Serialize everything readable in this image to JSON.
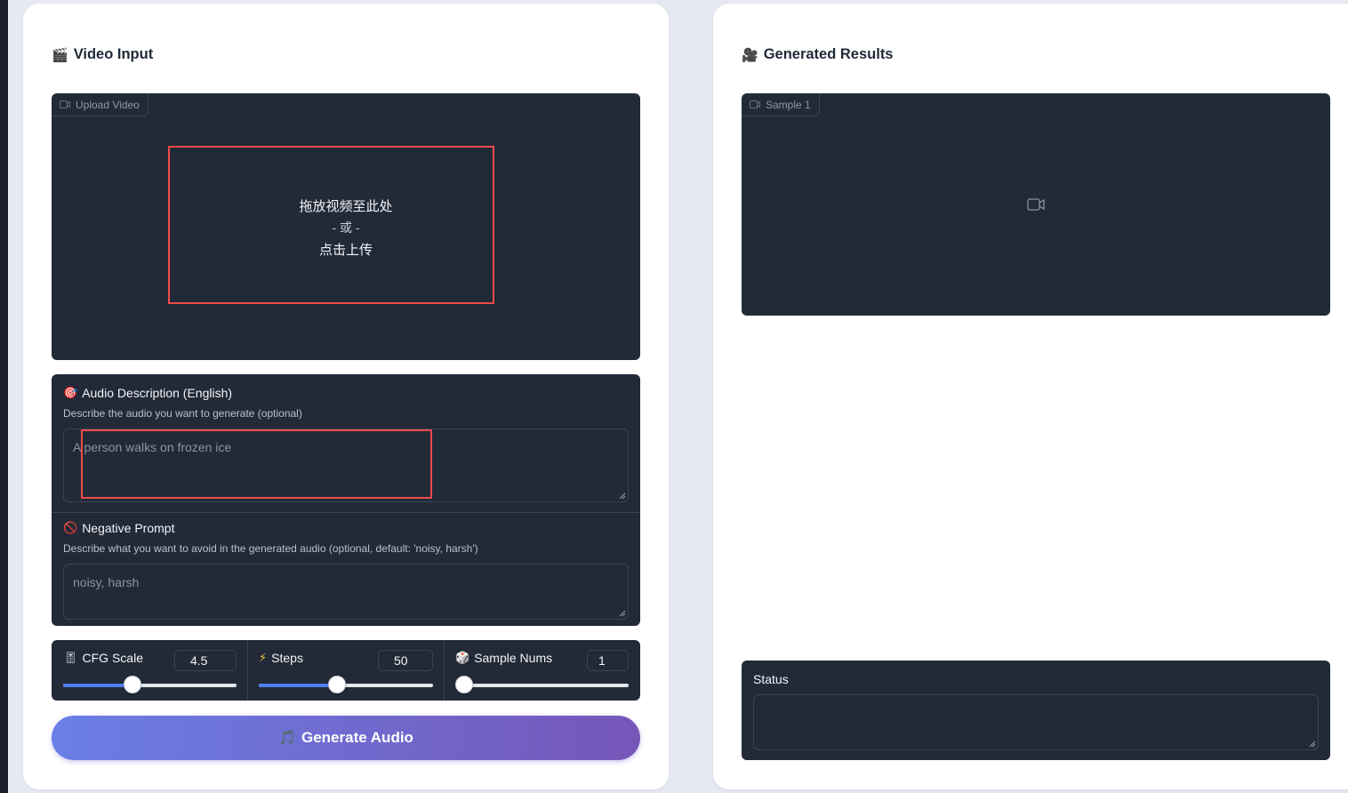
{
  "left": {
    "title": "Video Input",
    "title_icon": "🎬",
    "upload": {
      "tag": "Upload Video",
      "line1": "拖放视频至此处",
      "line2": "- 或 -",
      "line3": "点击上传"
    },
    "audio_description": {
      "icon": "🎯",
      "label": "Audio Description (English)",
      "info": "Describe the audio you want to generate (optional)",
      "placeholder": "A person walks on frozen ice"
    },
    "negative_prompt": {
      "icon": "🚫",
      "label": "Negative Prompt",
      "info": "Describe what you want to avoid in the generated audio (optional, default: 'noisy, harsh')",
      "placeholder": "noisy, harsh"
    },
    "sliders": [
      {
        "icon": "🎚",
        "label": "CFG Scale",
        "value": "4.5",
        "fraction": 0.4
      },
      {
        "icon": "⚡",
        "label": "Steps",
        "value": "50",
        "fraction": 0.45
      },
      {
        "icon": "🎲",
        "label": "Sample Nums",
        "value": "1",
        "fraction": 0.0
      }
    ],
    "generate_button": {
      "icon": "🎵",
      "label": "Generate Audio"
    }
  },
  "right": {
    "title": "Generated Results",
    "title_icon": "🎥",
    "sample_tag": "Sample 1",
    "status_label": "Status",
    "status_value": ""
  },
  "colors": {
    "accent_blue": "#4f7ff0",
    "highlight_red": "#ef4a4a",
    "dark_box": "#222a38"
  }
}
